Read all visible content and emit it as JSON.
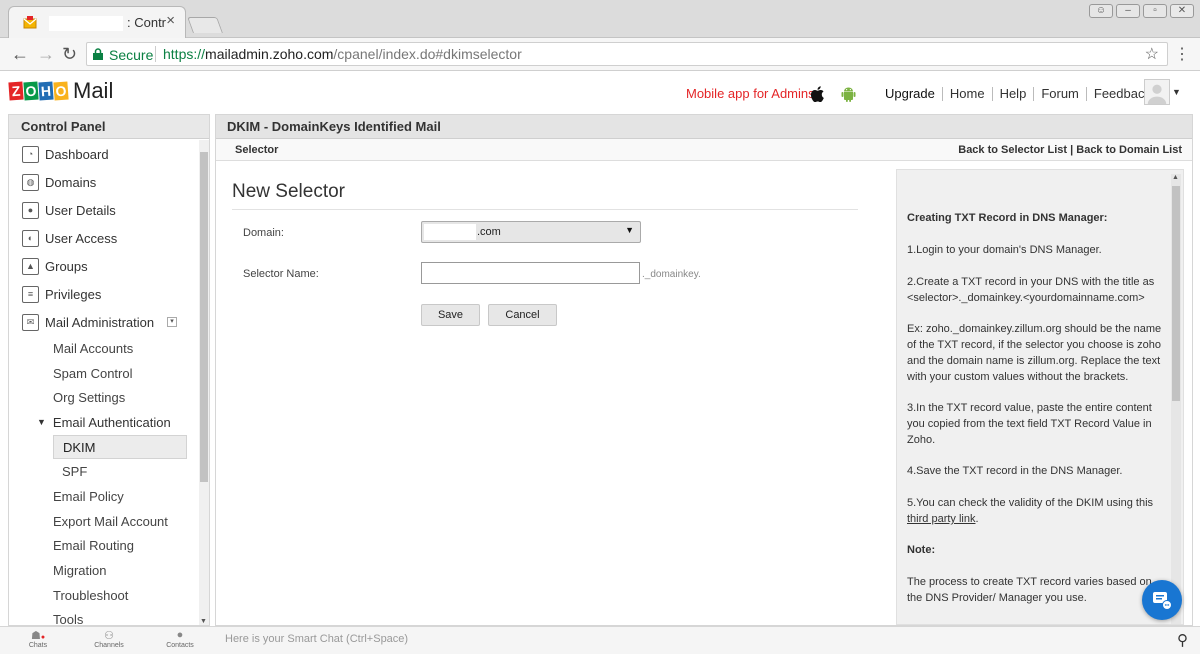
{
  "browser": {
    "tab_title": ": Contr",
    "tab_close": "×",
    "secure_label": "Secure",
    "url_scheme": "https://",
    "url_host": "mailadmin.zoho.com",
    "url_path": "/cpanel/index.do#dkimselector"
  },
  "header": {
    "logo_letters": [
      "Z",
      "O",
      "H",
      "O"
    ],
    "logo_colors": [
      "#e42527",
      "#089949",
      "#226db4",
      "#f9b21d"
    ],
    "logo_word": "Mail",
    "mobile_app": "Mobile app for Admins",
    "nav": [
      "Upgrade",
      "Home",
      "Help",
      "Forum",
      "Feedback"
    ]
  },
  "sidebar": {
    "title": "Control Panel",
    "items": [
      {
        "label": "Dashboard",
        "icon": "dashboard-icon"
      },
      {
        "label": "Domains",
        "icon": "globe-icon"
      },
      {
        "label": "User Details",
        "icon": "user-icon"
      },
      {
        "label": "User Access",
        "icon": "user-access-icon"
      },
      {
        "label": "Groups",
        "icon": "groups-icon"
      },
      {
        "label": "Privileges",
        "icon": "privileges-icon"
      },
      {
        "label": "Mail Administration",
        "icon": "mail-icon"
      }
    ],
    "sub_items": [
      "Mail Accounts",
      "Spam Control",
      "Org Settings"
    ],
    "email_auth": "Email Authentication",
    "auth_items": [
      "DKIM",
      "SPF"
    ],
    "more_items": [
      "Email Policy",
      "Export Mail Account",
      "Email Routing",
      "Migration",
      "Troubleshoot",
      "Tools"
    ]
  },
  "bottom": {
    "chats": "Chats",
    "channels": "Channels",
    "contacts": "Contacts",
    "smart_chat": "Here is your Smart Chat (Ctrl+Space)"
  },
  "main": {
    "title": "DKIM - DomainKeys Identified Mail",
    "tab": "Selector",
    "back_links": "Back to Selector List | Back to Domain List",
    "form_title": "New Selector",
    "domain_label": "Domain:",
    "domain_value": ".com",
    "selector_label": "Selector Name:",
    "selector_value": "",
    "selector_suffix": "._domainkey.",
    "save": "Save",
    "cancel": "Cancel"
  },
  "help": {
    "title": "Creating TXT Record in DNS Manager:",
    "step1": "1.Login to your domain's DNS Manager.",
    "step2": "2.Create a TXT record in your DNS with the title as <selector>._domainkey.<yourdomainname.com>",
    "example": "Ex: zoho._domainkey.zillum.org should be the name of the TXT record, if the selector you choose is zoho and the domain name is zillum.org. Replace the text with your custom values without the brackets.",
    "step3": "3.In the TXT record value, paste the entire content you copied from the text field TXT Record Value in Zoho.",
    "step4": "4.Save the TXT record in the DNS Manager.",
    "step5": "5.You can check the validity of the DKIM using this",
    "step5_link": "third party link",
    "note_title": "Note:",
    "note": "The process to create TXT record varies based on the DNS Provider/ Manager you use."
  }
}
